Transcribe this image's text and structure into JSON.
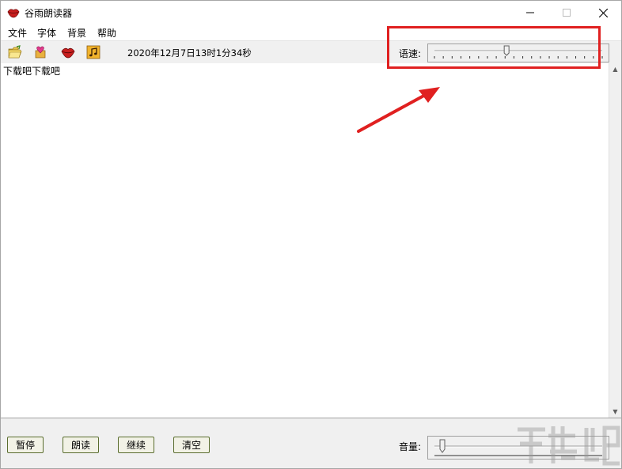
{
  "window": {
    "title": "谷雨朗读器",
    "app_icon": "lips-icon"
  },
  "menu": {
    "items": [
      "文件",
      "字体",
      "背景",
      "帮助"
    ]
  },
  "toolbar": {
    "buttons": [
      {
        "icon": "open-folder-icon"
      },
      {
        "icon": "heart-box-icon"
      },
      {
        "icon": "lips-icon"
      },
      {
        "icon": "music-note-icon"
      }
    ],
    "datetime": "2020年12月7日13时1分34秒",
    "speed_label": "语速:"
  },
  "speed_slider": {
    "value_fraction": 0.43,
    "ticks": 20
  },
  "editor": {
    "text": "下载吧下载吧"
  },
  "buttons": {
    "pause": "暂停",
    "read": "朗读",
    "continue": "继续",
    "clear": "清空"
  },
  "volume": {
    "label": "音量:",
    "value_fraction": 0.0
  },
  "colors": {
    "annotation": "#e02020",
    "button_border": "#5a6d2e",
    "toolbar_bg": "#f0f0f0"
  }
}
